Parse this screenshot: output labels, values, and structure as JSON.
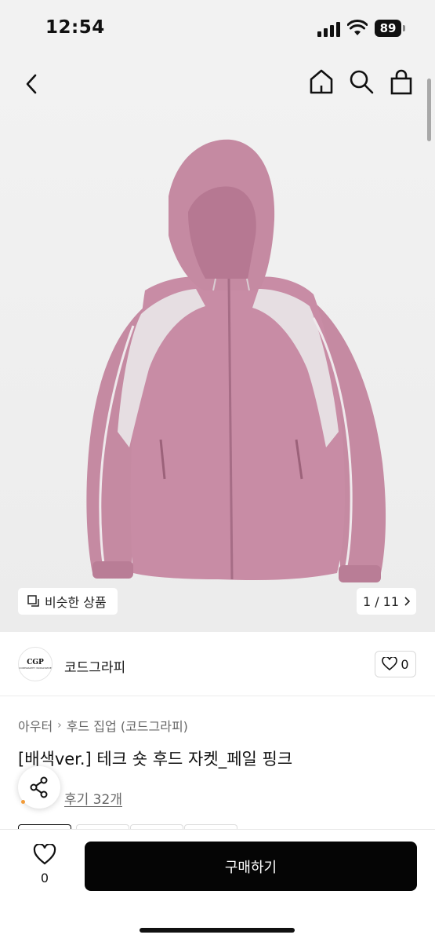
{
  "status_bar": {
    "time": "12:54",
    "battery": "89"
  },
  "header": {
    "icons": [
      "back-arrow-icon",
      "home-icon",
      "search-icon",
      "shopping-bag-icon"
    ]
  },
  "hero": {
    "similar_label": "비슷한 상품",
    "pager": "1 / 11",
    "image_description_colors": {
      "jacket": "#c98da6",
      "background": "#f2f2f2"
    }
  },
  "shop": {
    "logo_text": "CGP",
    "logo_subtext": "CODEGRAPHY WORLDWIDE",
    "name": "코드그라피",
    "likes": "0"
  },
  "product": {
    "breadcrumb": [
      "아우터",
      "후드 집업 (코드그라피)"
    ],
    "title": "[배색ver.] 테크 숏 후드 자켓_페일 핑크",
    "review": "후기 32개"
  },
  "bottom_bar": {
    "wish_count": "0",
    "buy_label": "구매하기"
  }
}
